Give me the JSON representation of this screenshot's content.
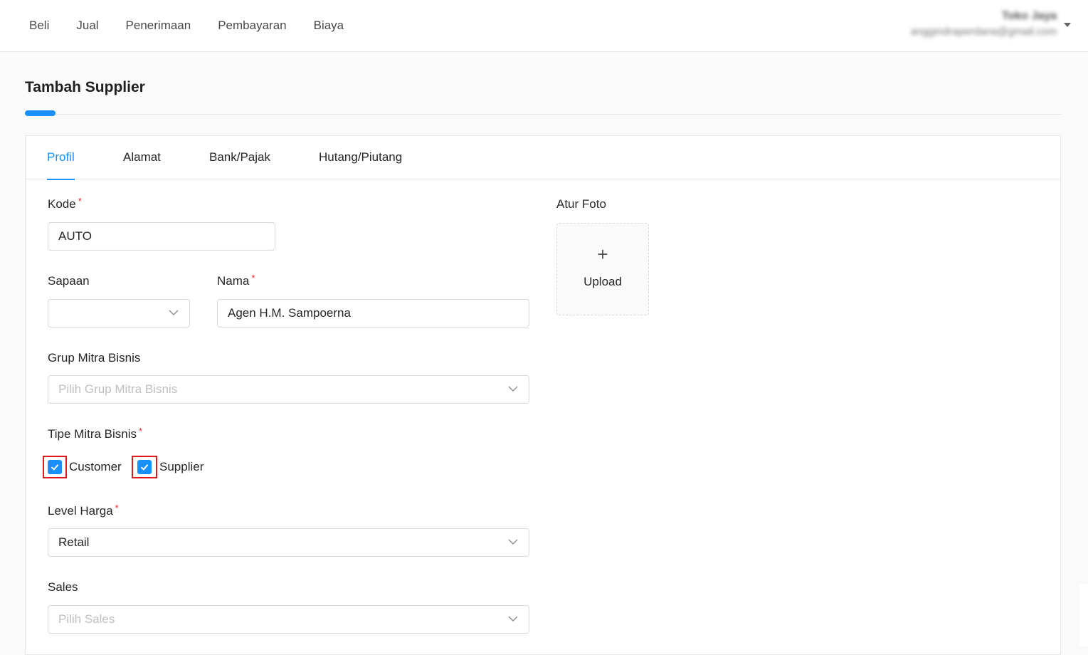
{
  "topnav": {
    "items": [
      "Beli",
      "Jual",
      "Penerimaan",
      "Pembayaran",
      "Biaya"
    ]
  },
  "user": {
    "name": "Toko Jaya",
    "email": "anggindraperdana@gmail.com"
  },
  "page": {
    "title": "Tambah Supplier"
  },
  "tabs": [
    "Profil",
    "Alamat",
    "Bank/Pajak",
    "Hutang/Piutang"
  ],
  "form": {
    "kode": {
      "label": "Kode",
      "value": "AUTO"
    },
    "sapaan": {
      "label": "Sapaan",
      "value": ""
    },
    "nama": {
      "label": "Nama",
      "value": "Agen H.M. Sampoerna"
    },
    "grup": {
      "label": "Grup Mitra Bisnis",
      "placeholder": "Pilih Grup Mitra Bisnis"
    },
    "tipe": {
      "label": "Tipe Mitra Bisnis",
      "options": [
        {
          "label": "Customer",
          "checked": true
        },
        {
          "label": "Supplier",
          "checked": true
        }
      ]
    },
    "level": {
      "label": "Level Harga",
      "value": "Retail"
    },
    "sales": {
      "label": "Sales",
      "placeholder": "Pilih Sales"
    },
    "required_mark": "*"
  },
  "foto": {
    "label": "Atur Foto",
    "plus": "+",
    "upload": "Upload"
  },
  "colors": {
    "accent": "#1890ff",
    "required": "#f5222d",
    "highlight": "#e0191e"
  }
}
